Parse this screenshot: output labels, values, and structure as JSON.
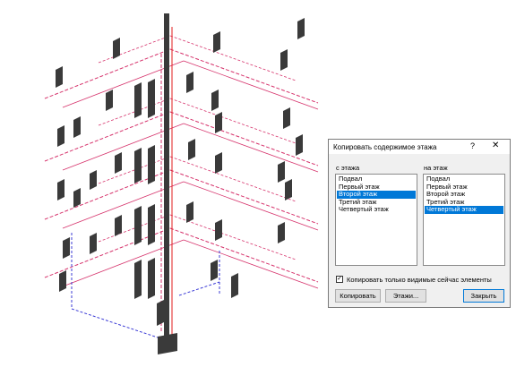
{
  "dialog": {
    "title": "Копировать содержимое этажа",
    "help_glyph": "?",
    "close_glyph": "✕",
    "from_label": "с этажа",
    "to_label": "на этаж",
    "from_floors": [
      "Подвал",
      "Первый этаж",
      "Второй этаж",
      "Третий этаж",
      "Четвертый этаж"
    ],
    "from_selected": "Второй этаж",
    "to_floors": [
      "Подвал",
      "Первый этаж",
      "Второй этаж",
      "Третий этаж",
      "Четвертый этаж"
    ],
    "to_selected": "Четвертый этаж",
    "visible_only_checkbox": {
      "label": "Копировать только видимые сейчас элементы",
      "checked": true
    },
    "copy_button": "Копировать",
    "floors_button": "Этажи...",
    "close_button": "Закрыть"
  },
  "colors": {
    "pipe_supply": "#d6336c",
    "pipe_return": "#3b3bd6",
    "pipe_red": "#e01b1b",
    "radiator": "#3a3a3a",
    "selection": "#0078d7"
  },
  "drawing": {
    "description_icons": [
      "radiator-icon",
      "riser-icon",
      "pipe-icon"
    ]
  }
}
